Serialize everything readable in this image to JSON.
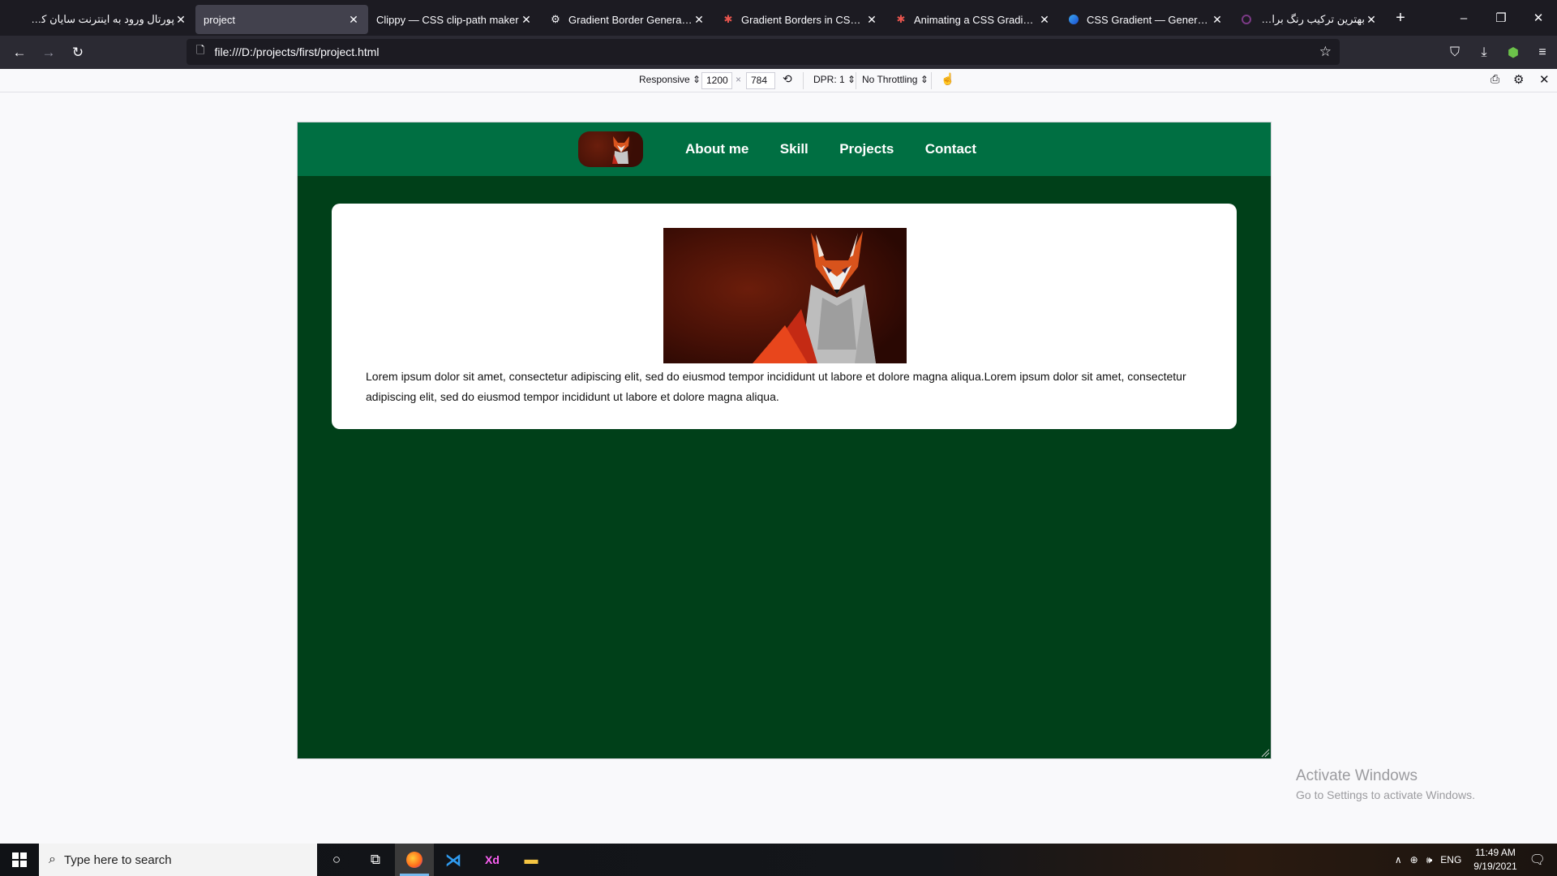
{
  "browser": {
    "tabs": [
      {
        "label": "پورتال ورود به اینترنت سایان کارت",
        "icon": "",
        "active": false
      },
      {
        "label": "project",
        "icon": "",
        "active": true
      },
      {
        "label": "Clippy — CSS clip-path maker",
        "icon": "",
        "active": false
      },
      {
        "label": "Gradient Border Generator",
        "icon": "gear-icon",
        "active": false
      },
      {
        "label": "Gradient Borders in CSS | CSS-Tricks",
        "icon": "asterisk-icon",
        "active": false
      },
      {
        "label": "Animating a CSS Gradient Border",
        "icon": "asterisk-icon",
        "active": false
      },
      {
        "label": "CSS Gradient — Generator, Maker",
        "icon": "circle-icon",
        "active": false
      },
      {
        "label": "بهترین ترکیب رنگ برای طراحی سایت",
        "icon": "ring-icon",
        "active": false
      }
    ],
    "url": "file:///D:/projects/first/project.html"
  },
  "rdm": {
    "device": "Responsive ⇕",
    "width": "1200",
    "times": "×",
    "height": "784",
    "dpr": "DPR: 1 ⇕",
    "throttle": "No Throttling ⇕"
  },
  "site": {
    "nav": [
      "About me",
      "Skill",
      "Projects",
      "Contact"
    ],
    "body_text": "Lorem ipsum dolor sit amet, consectetur adipiscing elit, sed do eiusmod tempor incididunt ut labore et dolore magna aliqua.Lorem ipsum dolor sit amet, consectetur adipiscing elit, sed do eiusmod tempor incididunt ut labore et dolore magna aliqua."
  },
  "watermark": {
    "line1": "Activate Windows",
    "line2": "Go to Settings to activate Windows."
  },
  "taskbar": {
    "search_placeholder": "Type here to search",
    "lang": "ENG",
    "time": "11:49 AM",
    "date": "9/19/2021"
  },
  "colors": {
    "header_green": "#006f42",
    "page_green": "#004019"
  }
}
